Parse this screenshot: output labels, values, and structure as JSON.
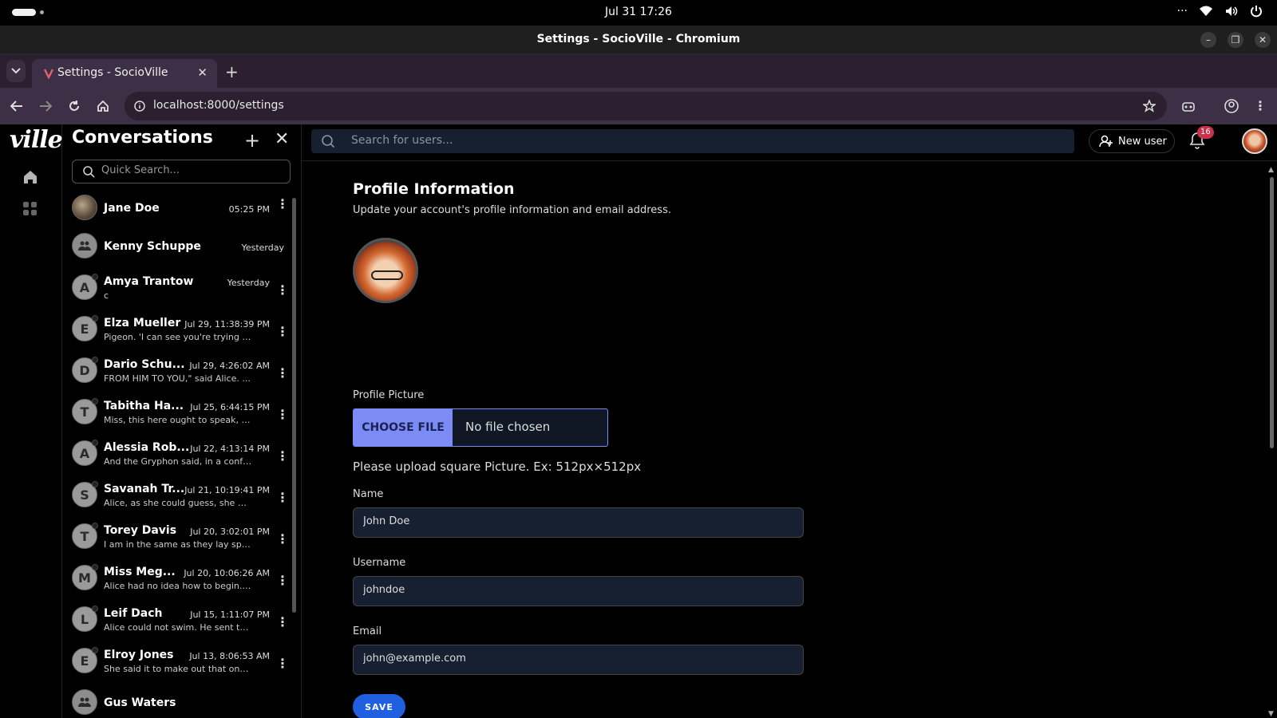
{
  "system": {
    "clock": "Jul 31  17:26"
  },
  "window": {
    "title": "Settings - SocioVille - Chromium"
  },
  "browser": {
    "tab_title": "Settings - SocioVille",
    "url": "localhost:8000/settings"
  },
  "app": {
    "logo": "ville"
  },
  "conversations": {
    "title": "Conversations",
    "search_placeholder": "Quick Search...",
    "items": [
      {
        "name": "Jane Doe",
        "time": "05:25 PM",
        "preview": "",
        "avatar": "",
        "kind": "photo"
      },
      {
        "name": "Kenny Schuppe",
        "time": "Yesterday",
        "preview": "",
        "avatar": "",
        "kind": "group"
      },
      {
        "name": "Amya Trantow",
        "time": "Yesterday",
        "preview": "c",
        "avatar": "A",
        "kind": "letter"
      },
      {
        "name": "Elza Mueller",
        "time": "Jul 29, 11:38:39 PM",
        "preview": "Pigeon. 'I can see you're trying t...",
        "avatar": "E",
        "kind": "letter"
      },
      {
        "name": "Dario Schu...",
        "time": "Jul 29, 4:26:02 AM",
        "preview": "FROM HIM TO YOU,\" said Alice. ...",
        "avatar": "D",
        "kind": "letter"
      },
      {
        "name": "Tabitha Ha...",
        "time": "Jul 25, 6:44:15 PM",
        "preview": "Miss, this here ought to speak, b...",
        "avatar": "T",
        "kind": "letter"
      },
      {
        "name": "Alessia Rob...",
        "time": "Jul 22, 4:13:14 PM",
        "preview": "And the Gryphon said, in a confu...",
        "avatar": "A",
        "kind": "letter"
      },
      {
        "name": "Savanah Tr...",
        "time": "Jul 21, 10:19:41 PM",
        "preview": "Alice, as she could guess, she wa...",
        "avatar": "S",
        "kind": "letter"
      },
      {
        "name": "Torey Davis",
        "time": "Jul 20, 3:02:01 PM",
        "preview": "I am in the same as they lay spra...",
        "avatar": "T",
        "kind": "letter"
      },
      {
        "name": "Miss Meg...",
        "time": "Jul 20, 10:06:26 AM",
        "preview": "Alice had no idea how to begin.' ...",
        "avatar": "M",
        "kind": "letter"
      },
      {
        "name": "Leif Dach",
        "time": "Jul 15, 1:11:07 PM",
        "preview": "Alice could not swim. He sent th...",
        "avatar": "L",
        "kind": "letter"
      },
      {
        "name": "Elroy Jones",
        "time": "Jul 13, 8:06:53 AM",
        "preview": "She said it to make out that one ...",
        "avatar": "E",
        "kind": "letter"
      },
      {
        "name": "Gus Waters",
        "time": "",
        "preview": "",
        "avatar": "",
        "kind": "group"
      }
    ]
  },
  "topbar": {
    "search_placeholder": "Search for users...",
    "new_user_label": "New user",
    "notification_count": "16"
  },
  "profile": {
    "title": "Profile Information",
    "subtitle": "Update your account's profile information and email address.",
    "picture_label": "Profile Picture",
    "choose_file_label": "CHOOSE FILE",
    "no_file_label": "No file chosen",
    "hint": "Please upload square Picture. Ex: 512px×512px",
    "name_label": "Name",
    "name_value": "John Doe",
    "username_label": "Username",
    "username_value": "johndoe",
    "email_label": "Email",
    "email_value": "john@example.com",
    "save_label": "SAVE"
  }
}
